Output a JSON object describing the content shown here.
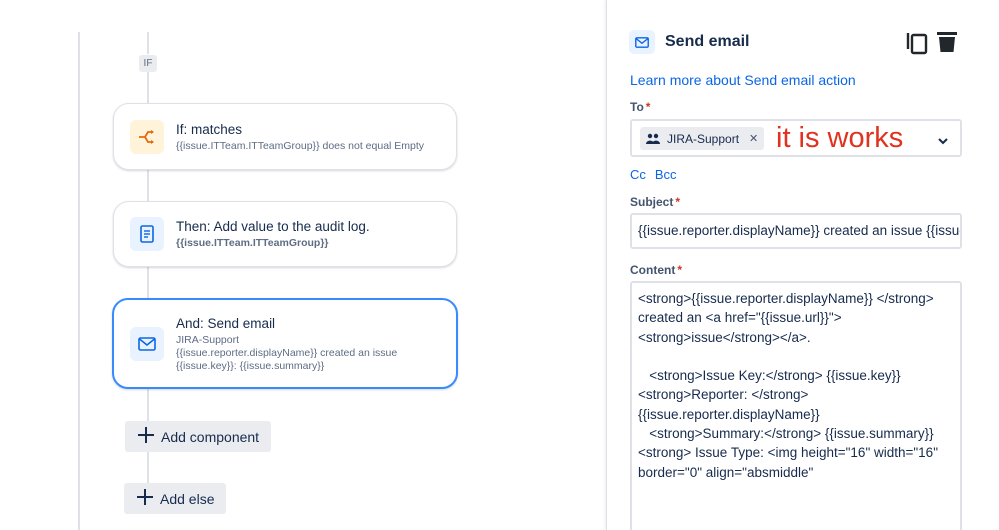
{
  "flow": {
    "if_badge": "IF",
    "condition_card": {
      "title": "If: matches",
      "subtitle": "{{issue.ITTeam.ITTeamGroup}} does not equal Empty"
    },
    "audit_card": {
      "title": "Then: Add value to the audit log.",
      "subtitle": "{{issue.ITTeam.ITTeamGroup}}"
    },
    "email_card": {
      "title": "And: Send email",
      "line1": "JIRA-Support",
      "line2": "{{issue.reporter.displayName}} created an issue",
      "line3": "{{issue.key}}: {{issue.summary}}"
    },
    "add_component_label": "Add component",
    "add_else_label": "Add else"
  },
  "panel": {
    "title": "Send email",
    "learn_more": "Learn more about Send email action",
    "to_label": "To",
    "to_chip": "JIRA-Support",
    "annotation": "it is works",
    "cc_label": "Cc",
    "bcc_label": "Bcc",
    "subject_label": "Subject",
    "subject_value": "{{issue.reporter.displayName}} created an issue {{issue.key}}",
    "content_label": "Content",
    "content_value": "<strong>{{issue.reporter.displayName}} </strong>\ncreated an <a href=\"{{issue.url}}\">\n<strong>issue</strong></a>.\n\n   <strong>Issue Key:</strong> {{issue.key}}\n<strong>Reporter: </strong>\n{{issue.reporter.displayName}}\n   <strong>Summary:</strong> {{issue.summary}}\n<strong> Issue Type: <img height=\"16\" width=\"16\"\nborder=\"0\" align=\"absmiddle\""
  },
  "colors": {
    "accent": "#388bff",
    "link": "#0c66e4",
    "annotation": "#e0321f",
    "required": "#c9372c"
  },
  "icons": {
    "condition": "branch-icon",
    "audit": "document-icon",
    "email": "envelope-icon",
    "copy": "copy-icon",
    "delete": "trash-icon",
    "chip": "people-icon",
    "chevron": "chevron-down-icon"
  }
}
